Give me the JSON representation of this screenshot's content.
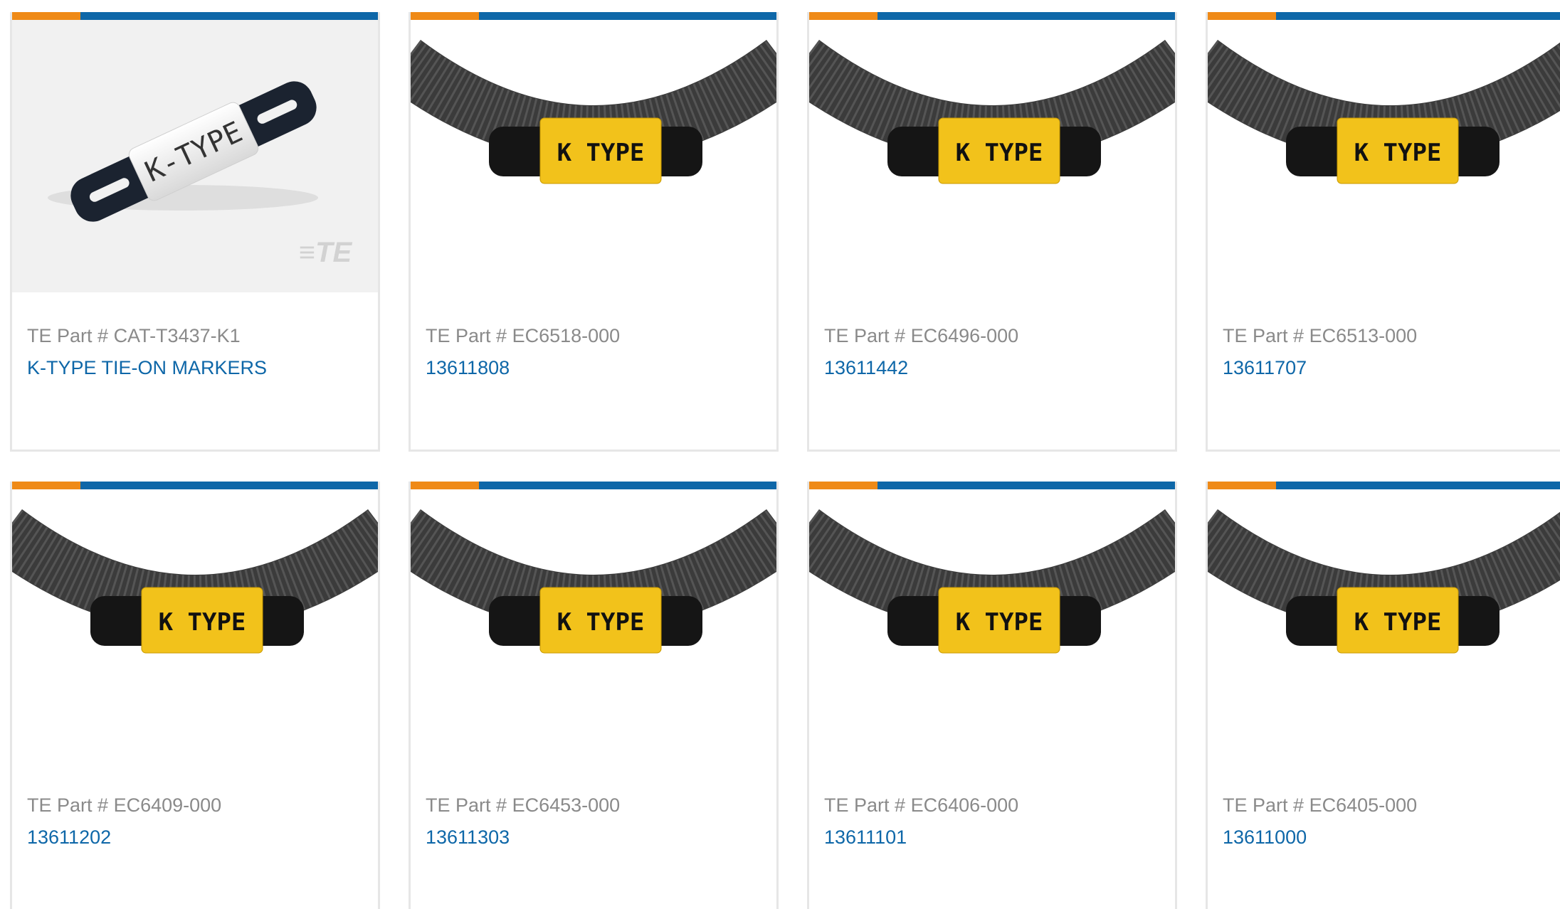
{
  "products": [
    {
      "part_label": "TE Part #",
      "part_number": "CAT-T3437-K1",
      "name": "K-TYPE TIE-ON MARKERS",
      "image": "k-type-tie-on-marker-white",
      "marker_text": "K-TYPE"
    },
    {
      "part_label": "TE Part #",
      "part_number": "EC6518-000",
      "name": "13611808",
      "image": "k-type-marker-on-conduit",
      "marker_text": "K TYPE"
    },
    {
      "part_label": "TE Part #",
      "part_number": "EC6496-000",
      "name": "13611442",
      "image": "k-type-marker-on-conduit",
      "marker_text": "K TYPE"
    },
    {
      "part_label": "TE Part #",
      "part_number": "EC6513-000",
      "name": "13611707",
      "image": "k-type-marker-on-conduit",
      "marker_text": "K TYPE"
    },
    {
      "part_label": "TE Part #",
      "part_number": "EC6409-000",
      "name": "13611202",
      "image": "k-type-marker-on-conduit",
      "marker_text": "K TYPE"
    },
    {
      "part_label": "TE Part #",
      "part_number": "EC6453-000",
      "name": "13611303",
      "image": "k-type-marker-on-conduit",
      "marker_text": "K TYPE"
    },
    {
      "part_label": "TE Part #",
      "part_number": "EC6406-000",
      "name": "13611101",
      "image": "k-type-marker-on-conduit",
      "marker_text": "K TYPE"
    },
    {
      "part_label": "TE Part #",
      "part_number": "EC6405-000",
      "name": "13611000",
      "image": "k-type-marker-on-conduit",
      "marker_text": "K TYPE"
    }
  ],
  "colors": {
    "accent_orange": "#ef8a17",
    "accent_blue": "#0e67a8",
    "part_text": "#8a8a8a",
    "link_text": "#0e67a8",
    "marker_yellow": "#f2c21b"
  }
}
